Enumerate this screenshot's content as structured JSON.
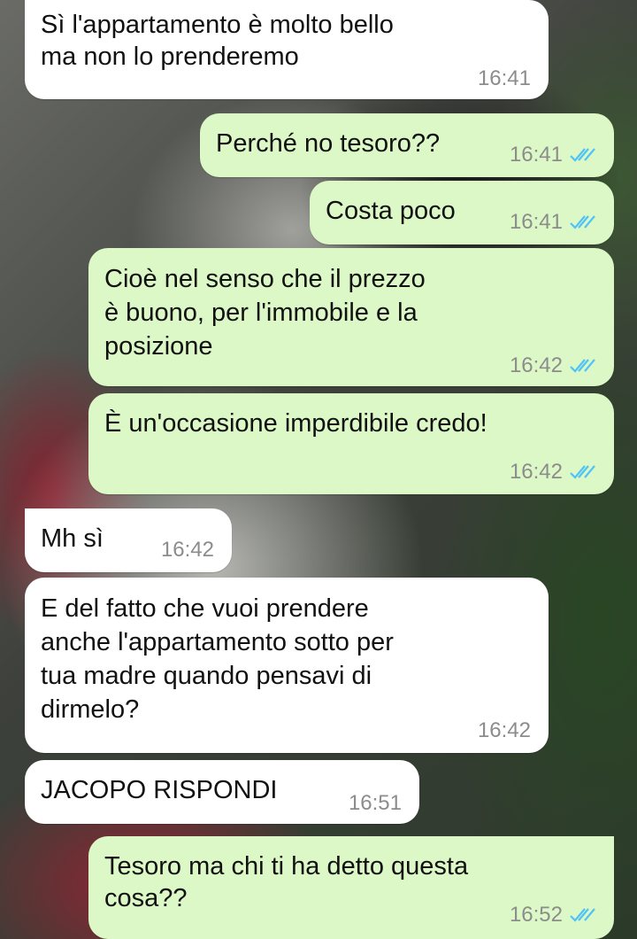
{
  "messages": [
    {
      "text": "Sì l'appartamento è molto bello\nma non lo prenderemo",
      "time": "16:41"
    },
    {
      "text": "Perché no tesoro??",
      "time": "16:41",
      "ticks": "read-ticks-icon"
    },
    {
      "text": "Costa poco",
      "time": "16:41",
      "ticks": "read-ticks-icon"
    },
    {
      "text": "Cioè nel senso che il prezzo\nè buono, per l'immobile e la\nposizione",
      "time": "16:42",
      "ticks": "read-ticks-icon"
    },
    {
      "text": "È un'occasione imperdibile credo!",
      "time": "16:42",
      "ticks": "read-ticks-icon"
    },
    {
      "text": "Mh sì",
      "time": "16:42"
    },
    {
      "text": "E del fatto che vuoi prendere\nanche l'appartamento sotto per\ntua madre quando pensavi di\ndirmelo?",
      "time": "16:42"
    },
    {
      "text": "JACOPO RISPONDI",
      "time": "16:51"
    },
    {
      "text": "Tesoro ma chi ti ha detto questa\ncosa??",
      "time": "16:52",
      "ticks": "read-ticks-icon"
    }
  ],
  "colors": {
    "incoming_bubble": "#ffffff",
    "outgoing_bubble": "#dcf8c6",
    "read_ticks": "#4fc3f7",
    "timestamp": "#8c8c8c"
  }
}
